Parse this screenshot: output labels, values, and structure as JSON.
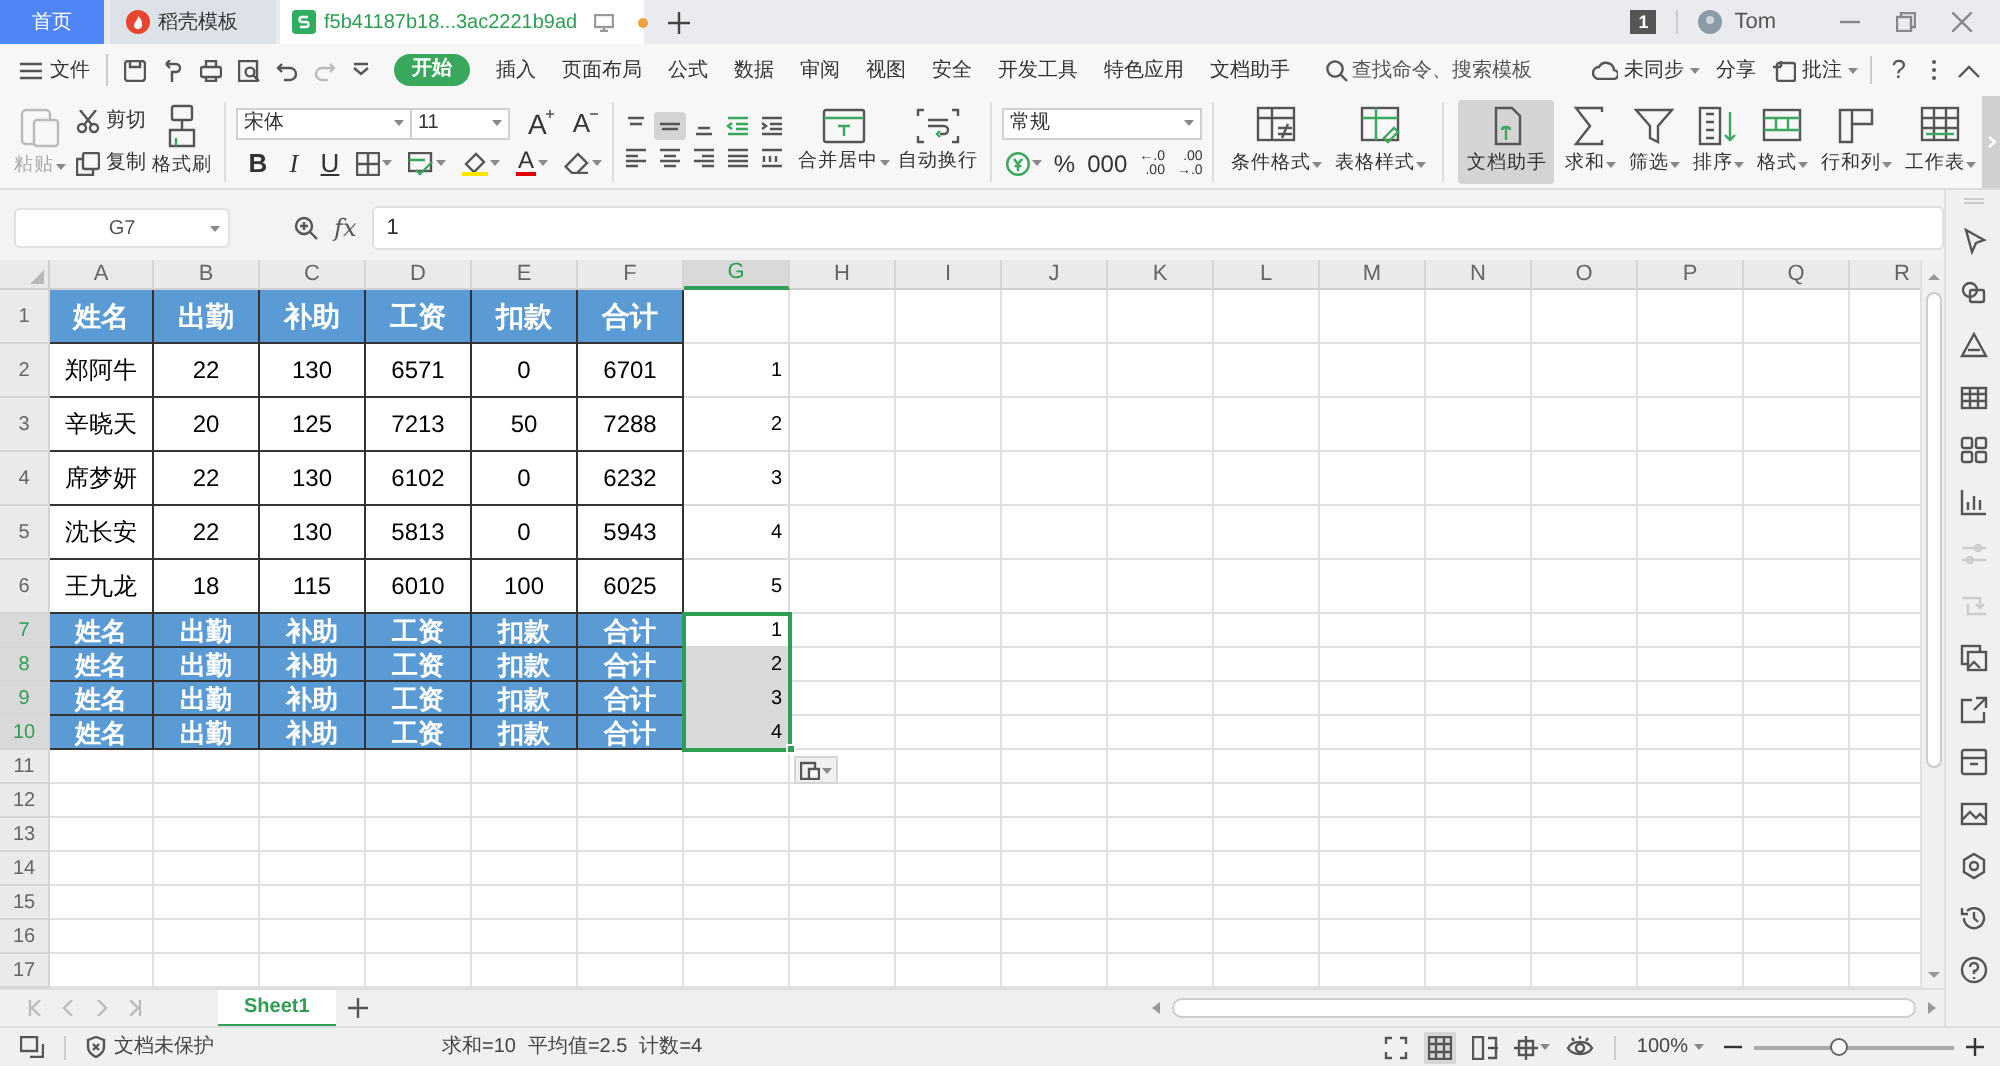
{
  "tabs": [
    {
      "kind": "home",
      "label": "首页",
      "selected": false
    },
    {
      "kind": "docer",
      "label": "稻壳模板",
      "selected": false
    },
    {
      "kind": "sheet",
      "label": "f5b41187b18...3ac2221b9ad",
      "selected": true,
      "unsaved": true
    }
  ],
  "account": {
    "badge": "1",
    "user": "Tom"
  },
  "menu": {
    "file": "文件",
    "tabs": [
      {
        "label": "开始",
        "selected": true
      },
      {
        "label": "插入",
        "selected": false
      },
      {
        "label": "页面布局",
        "selected": false
      },
      {
        "label": "公式",
        "selected": false
      },
      {
        "label": "数据",
        "selected": false
      },
      {
        "label": "审阅",
        "selected": false
      },
      {
        "label": "视图",
        "selected": false
      },
      {
        "label": "安全",
        "selected": false
      },
      {
        "label": "开发工具",
        "selected": false
      },
      {
        "label": "特色应用",
        "selected": false
      },
      {
        "label": "文档助手",
        "selected": false
      }
    ],
    "search": "查找命令、搜索模板",
    "sync": "未同步",
    "share": "分享",
    "comment": "批注",
    "help": "?"
  },
  "ribbon": {
    "paste": {
      "label": "粘贴",
      "disabled": true
    },
    "clipboard": [
      {
        "kind": "cut",
        "label": "剪切"
      },
      {
        "kind": "copy",
        "label": "复制"
      }
    ],
    "format_painter": "格式刷",
    "font": {
      "name": "宋体",
      "size": "11",
      "grow": "A",
      "shrink": "A"
    },
    "text_styles": [
      {
        "kind": "bold",
        "label": "B"
      },
      {
        "kind": "italic",
        "label": "I"
      },
      {
        "kind": "underline",
        "label": "U"
      }
    ],
    "font_color": "A",
    "merge": "合并居中",
    "wrap": "自动换行",
    "number_format": "常规",
    "number_buttons": [
      {
        "kind": "currency"
      },
      {
        "kind": "text",
        "label": "%"
      },
      {
        "kind": "text",
        "label": "000"
      },
      {
        "kind": "decimal",
        "top": "←.0",
        "bottom": ".00"
      },
      {
        "kind": "decimal",
        "top": ".00",
        "bottom": "→.0"
      }
    ],
    "large_buttons": [
      {
        "kind": "conditional",
        "label": "条件格式",
        "selected": false
      },
      {
        "kind": "table_style",
        "label": "表格样式",
        "selected": false
      },
      {
        "kind": "assistant",
        "label": "文档助手",
        "selected": true
      },
      {
        "kind": "sum",
        "label": "求和",
        "selected": false
      },
      {
        "kind": "filter",
        "label": "筛选",
        "selected": false
      },
      {
        "kind": "sort",
        "label": "排序",
        "selected": false
      },
      {
        "kind": "format",
        "label": "格式",
        "selected": false
      },
      {
        "kind": "rowcol",
        "label": "行和列",
        "selected": false
      },
      {
        "kind": "worksheet",
        "label": "工作表",
        "selected": false
      }
    ]
  },
  "formula_bar": {
    "name_box": "G7",
    "function_label": "fx",
    "formula": "1"
  },
  "sheet": {
    "columns": [
      {
        "label": "A",
        "selected": false
      },
      {
        "label": "B",
        "selected": false
      },
      {
        "label": "C",
        "selected": false
      },
      {
        "label": "D",
        "selected": false
      },
      {
        "label": "E",
        "selected": false
      },
      {
        "label": "F",
        "selected": false
      },
      {
        "label": "G",
        "selected": true
      },
      {
        "label": "H",
        "selected": false
      },
      {
        "label": "I",
        "selected": false
      },
      {
        "label": "J",
        "selected": false
      },
      {
        "label": "K",
        "selected": false
      },
      {
        "label": "L",
        "selected": false
      },
      {
        "label": "M",
        "selected": false
      },
      {
        "label": "N",
        "selected": false
      },
      {
        "label": "O",
        "selected": false
      },
      {
        "label": "P",
        "selected": false
      },
      {
        "label": "Q",
        "selected": false
      },
      {
        "label": "R",
        "selected": false
      }
    ],
    "rows": [
      {
        "number": "1",
        "kind": "header",
        "selected": false,
        "cells": [
          "姓名",
          "出勤",
          "补助",
          "工资",
          "扣款",
          "合计"
        ]
      },
      {
        "number": "2",
        "kind": "data",
        "selected": false,
        "cells": [
          "郑阿牛",
          "22",
          "130",
          "6571",
          "0",
          "6701"
        ],
        "g": {
          "value": "1",
          "selected": false
        }
      },
      {
        "number": "3",
        "kind": "data",
        "selected": false,
        "cells": [
          "辛晓天",
          "20",
          "125",
          "7213",
          "50",
          "7288"
        ],
        "g": {
          "value": "2",
          "selected": false
        }
      },
      {
        "number": "4",
        "kind": "data",
        "selected": false,
        "cells": [
          "席梦妍",
          "22",
          "130",
          "6102",
          "0",
          "6232"
        ],
        "g": {
          "value": "3",
          "selected": false
        }
      },
      {
        "number": "5",
        "kind": "data",
        "selected": false,
        "cells": [
          "沈长安",
          "22",
          "130",
          "5813",
          "0",
          "5943"
        ],
        "g": {
          "value": "4",
          "selected": false
        }
      },
      {
        "number": "6",
        "kind": "data",
        "selected": false,
        "cells": [
          "王九龙",
          "18",
          "115",
          "6010",
          "100",
          "6025"
        ],
        "g": {
          "value": "5",
          "selected": false
        }
      },
      {
        "number": "7",
        "kind": "header_compact",
        "selected": true,
        "cells": [
          "姓名",
          "出勤",
          "补助",
          "工资",
          "扣款",
          "合计"
        ],
        "g": {
          "value": "1",
          "selected": true,
          "active": true
        }
      },
      {
        "number": "8",
        "kind": "header_compact",
        "selected": true,
        "cells": [
          "姓名",
          "出勤",
          "补助",
          "工资",
          "扣款",
          "合计"
        ],
        "g": {
          "value": "2",
          "selected": true,
          "active": false
        }
      },
      {
        "number": "9",
        "kind": "header_compact",
        "selected": true,
        "cells": [
          "姓名",
          "出勤",
          "补助",
          "工资",
          "扣款",
          "合计"
        ],
        "g": {
          "value": "3",
          "selected": true,
          "active": false
        }
      },
      {
        "number": "10",
        "kind": "header_compact",
        "selected": true,
        "cells": [
          "姓名",
          "出勤",
          "补助",
          "工资",
          "扣款",
          "合计"
        ],
        "g": {
          "value": "4",
          "selected": true,
          "active": false
        }
      },
      {
        "number": "11",
        "kind": "empty",
        "selected": false
      },
      {
        "number": "12",
        "kind": "empty",
        "selected": false
      },
      {
        "number": "13",
        "kind": "empty",
        "selected": false
      },
      {
        "number": "14",
        "kind": "empty",
        "selected": false
      },
      {
        "number": "15",
        "kind": "empty",
        "selected": false
      },
      {
        "number": "16",
        "kind": "empty",
        "selected": false
      },
      {
        "number": "17",
        "kind": "empty",
        "selected": false
      }
    ]
  },
  "sheet_tabs": [
    {
      "label": "Sheet1",
      "selected": true
    }
  ],
  "status_bar": {
    "protection": "文档未保护",
    "stats": [
      "求和=10",
      "平均值=2.5",
      "计数=4"
    ],
    "zoom": "100%",
    "zoom_slider": {
      "level": 0.42
    }
  }
}
